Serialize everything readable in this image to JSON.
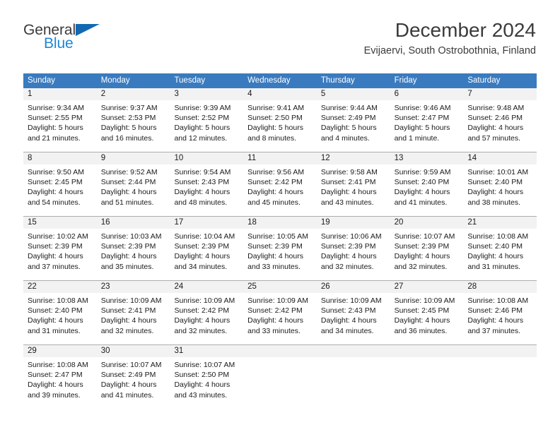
{
  "logo": {
    "line1": "General",
    "line2": "Blue",
    "triangle_color": "#1268b3",
    "line2_color": "#1e87d6"
  },
  "header": {
    "title": "December 2024",
    "subtitle": "Evijaervi, South Ostrobothnia, Finland"
  },
  "theme": {
    "header_row_bg": "#3a7bbf",
    "header_row_text": "#ffffff",
    "day_number_bg": "#f2f2f2",
    "cell_bg": "#ffffff",
    "row_divider": "#adadad",
    "text": "#1a1a1a"
  },
  "weekdays": [
    "Sunday",
    "Monday",
    "Tuesday",
    "Wednesday",
    "Thursday",
    "Friday",
    "Saturday"
  ],
  "weeks": [
    [
      {
        "day": "1",
        "lines": [
          "Sunrise: 9:34 AM",
          "Sunset: 2:55 PM",
          "Daylight: 5 hours",
          "and 21 minutes."
        ]
      },
      {
        "day": "2",
        "lines": [
          "Sunrise: 9:37 AM",
          "Sunset: 2:53 PM",
          "Daylight: 5 hours",
          "and 16 minutes."
        ]
      },
      {
        "day": "3",
        "lines": [
          "Sunrise: 9:39 AM",
          "Sunset: 2:52 PM",
          "Daylight: 5 hours",
          "and 12 minutes."
        ]
      },
      {
        "day": "4",
        "lines": [
          "Sunrise: 9:41 AM",
          "Sunset: 2:50 PM",
          "Daylight: 5 hours",
          "and 8 minutes."
        ]
      },
      {
        "day": "5",
        "lines": [
          "Sunrise: 9:44 AM",
          "Sunset: 2:49 PM",
          "Daylight: 5 hours",
          "and 4 minutes."
        ]
      },
      {
        "day": "6",
        "lines": [
          "Sunrise: 9:46 AM",
          "Sunset: 2:47 PM",
          "Daylight: 5 hours",
          "and 1 minute."
        ]
      },
      {
        "day": "7",
        "lines": [
          "Sunrise: 9:48 AM",
          "Sunset: 2:46 PM",
          "Daylight: 4 hours",
          "and 57 minutes."
        ]
      }
    ],
    [
      {
        "day": "8",
        "lines": [
          "Sunrise: 9:50 AM",
          "Sunset: 2:45 PM",
          "Daylight: 4 hours",
          "and 54 minutes."
        ]
      },
      {
        "day": "9",
        "lines": [
          "Sunrise: 9:52 AM",
          "Sunset: 2:44 PM",
          "Daylight: 4 hours",
          "and 51 minutes."
        ]
      },
      {
        "day": "10",
        "lines": [
          "Sunrise: 9:54 AM",
          "Sunset: 2:43 PM",
          "Daylight: 4 hours",
          "and 48 minutes."
        ]
      },
      {
        "day": "11",
        "lines": [
          "Sunrise: 9:56 AM",
          "Sunset: 2:42 PM",
          "Daylight: 4 hours",
          "and 45 minutes."
        ]
      },
      {
        "day": "12",
        "lines": [
          "Sunrise: 9:58 AM",
          "Sunset: 2:41 PM",
          "Daylight: 4 hours",
          "and 43 minutes."
        ]
      },
      {
        "day": "13",
        "lines": [
          "Sunrise: 9:59 AM",
          "Sunset: 2:40 PM",
          "Daylight: 4 hours",
          "and 41 minutes."
        ]
      },
      {
        "day": "14",
        "lines": [
          "Sunrise: 10:01 AM",
          "Sunset: 2:40 PM",
          "Daylight: 4 hours",
          "and 38 minutes."
        ]
      }
    ],
    [
      {
        "day": "15",
        "lines": [
          "Sunrise: 10:02 AM",
          "Sunset: 2:39 PM",
          "Daylight: 4 hours",
          "and 37 minutes."
        ]
      },
      {
        "day": "16",
        "lines": [
          "Sunrise: 10:03 AM",
          "Sunset: 2:39 PM",
          "Daylight: 4 hours",
          "and 35 minutes."
        ]
      },
      {
        "day": "17",
        "lines": [
          "Sunrise: 10:04 AM",
          "Sunset: 2:39 PM",
          "Daylight: 4 hours",
          "and 34 minutes."
        ]
      },
      {
        "day": "18",
        "lines": [
          "Sunrise: 10:05 AM",
          "Sunset: 2:39 PM",
          "Daylight: 4 hours",
          "and 33 minutes."
        ]
      },
      {
        "day": "19",
        "lines": [
          "Sunrise: 10:06 AM",
          "Sunset: 2:39 PM",
          "Daylight: 4 hours",
          "and 32 minutes."
        ]
      },
      {
        "day": "20",
        "lines": [
          "Sunrise: 10:07 AM",
          "Sunset: 2:39 PM",
          "Daylight: 4 hours",
          "and 32 minutes."
        ]
      },
      {
        "day": "21",
        "lines": [
          "Sunrise: 10:08 AM",
          "Sunset: 2:40 PM",
          "Daylight: 4 hours",
          "and 31 minutes."
        ]
      }
    ],
    [
      {
        "day": "22",
        "lines": [
          "Sunrise: 10:08 AM",
          "Sunset: 2:40 PM",
          "Daylight: 4 hours",
          "and 31 minutes."
        ]
      },
      {
        "day": "23",
        "lines": [
          "Sunrise: 10:09 AM",
          "Sunset: 2:41 PM",
          "Daylight: 4 hours",
          "and 32 minutes."
        ]
      },
      {
        "day": "24",
        "lines": [
          "Sunrise: 10:09 AM",
          "Sunset: 2:42 PM",
          "Daylight: 4 hours",
          "and 32 minutes."
        ]
      },
      {
        "day": "25",
        "lines": [
          "Sunrise: 10:09 AM",
          "Sunset: 2:42 PM",
          "Daylight: 4 hours",
          "and 33 minutes."
        ]
      },
      {
        "day": "26",
        "lines": [
          "Sunrise: 10:09 AM",
          "Sunset: 2:43 PM",
          "Daylight: 4 hours",
          "and 34 minutes."
        ]
      },
      {
        "day": "27",
        "lines": [
          "Sunrise: 10:09 AM",
          "Sunset: 2:45 PM",
          "Daylight: 4 hours",
          "and 36 minutes."
        ]
      },
      {
        "day": "28",
        "lines": [
          "Sunrise: 10:08 AM",
          "Sunset: 2:46 PM",
          "Daylight: 4 hours",
          "and 37 minutes."
        ]
      }
    ],
    [
      {
        "day": "29",
        "lines": [
          "Sunrise: 10:08 AM",
          "Sunset: 2:47 PM",
          "Daylight: 4 hours",
          "and 39 minutes."
        ]
      },
      {
        "day": "30",
        "lines": [
          "Sunrise: 10:07 AM",
          "Sunset: 2:49 PM",
          "Daylight: 4 hours",
          "and 41 minutes."
        ]
      },
      {
        "day": "31",
        "lines": [
          "Sunrise: 10:07 AM",
          "Sunset: 2:50 PM",
          "Daylight: 4 hours",
          "and 43 minutes."
        ]
      },
      {
        "day": "",
        "lines": []
      },
      {
        "day": "",
        "lines": []
      },
      {
        "day": "",
        "lines": []
      },
      {
        "day": "",
        "lines": []
      }
    ]
  ]
}
